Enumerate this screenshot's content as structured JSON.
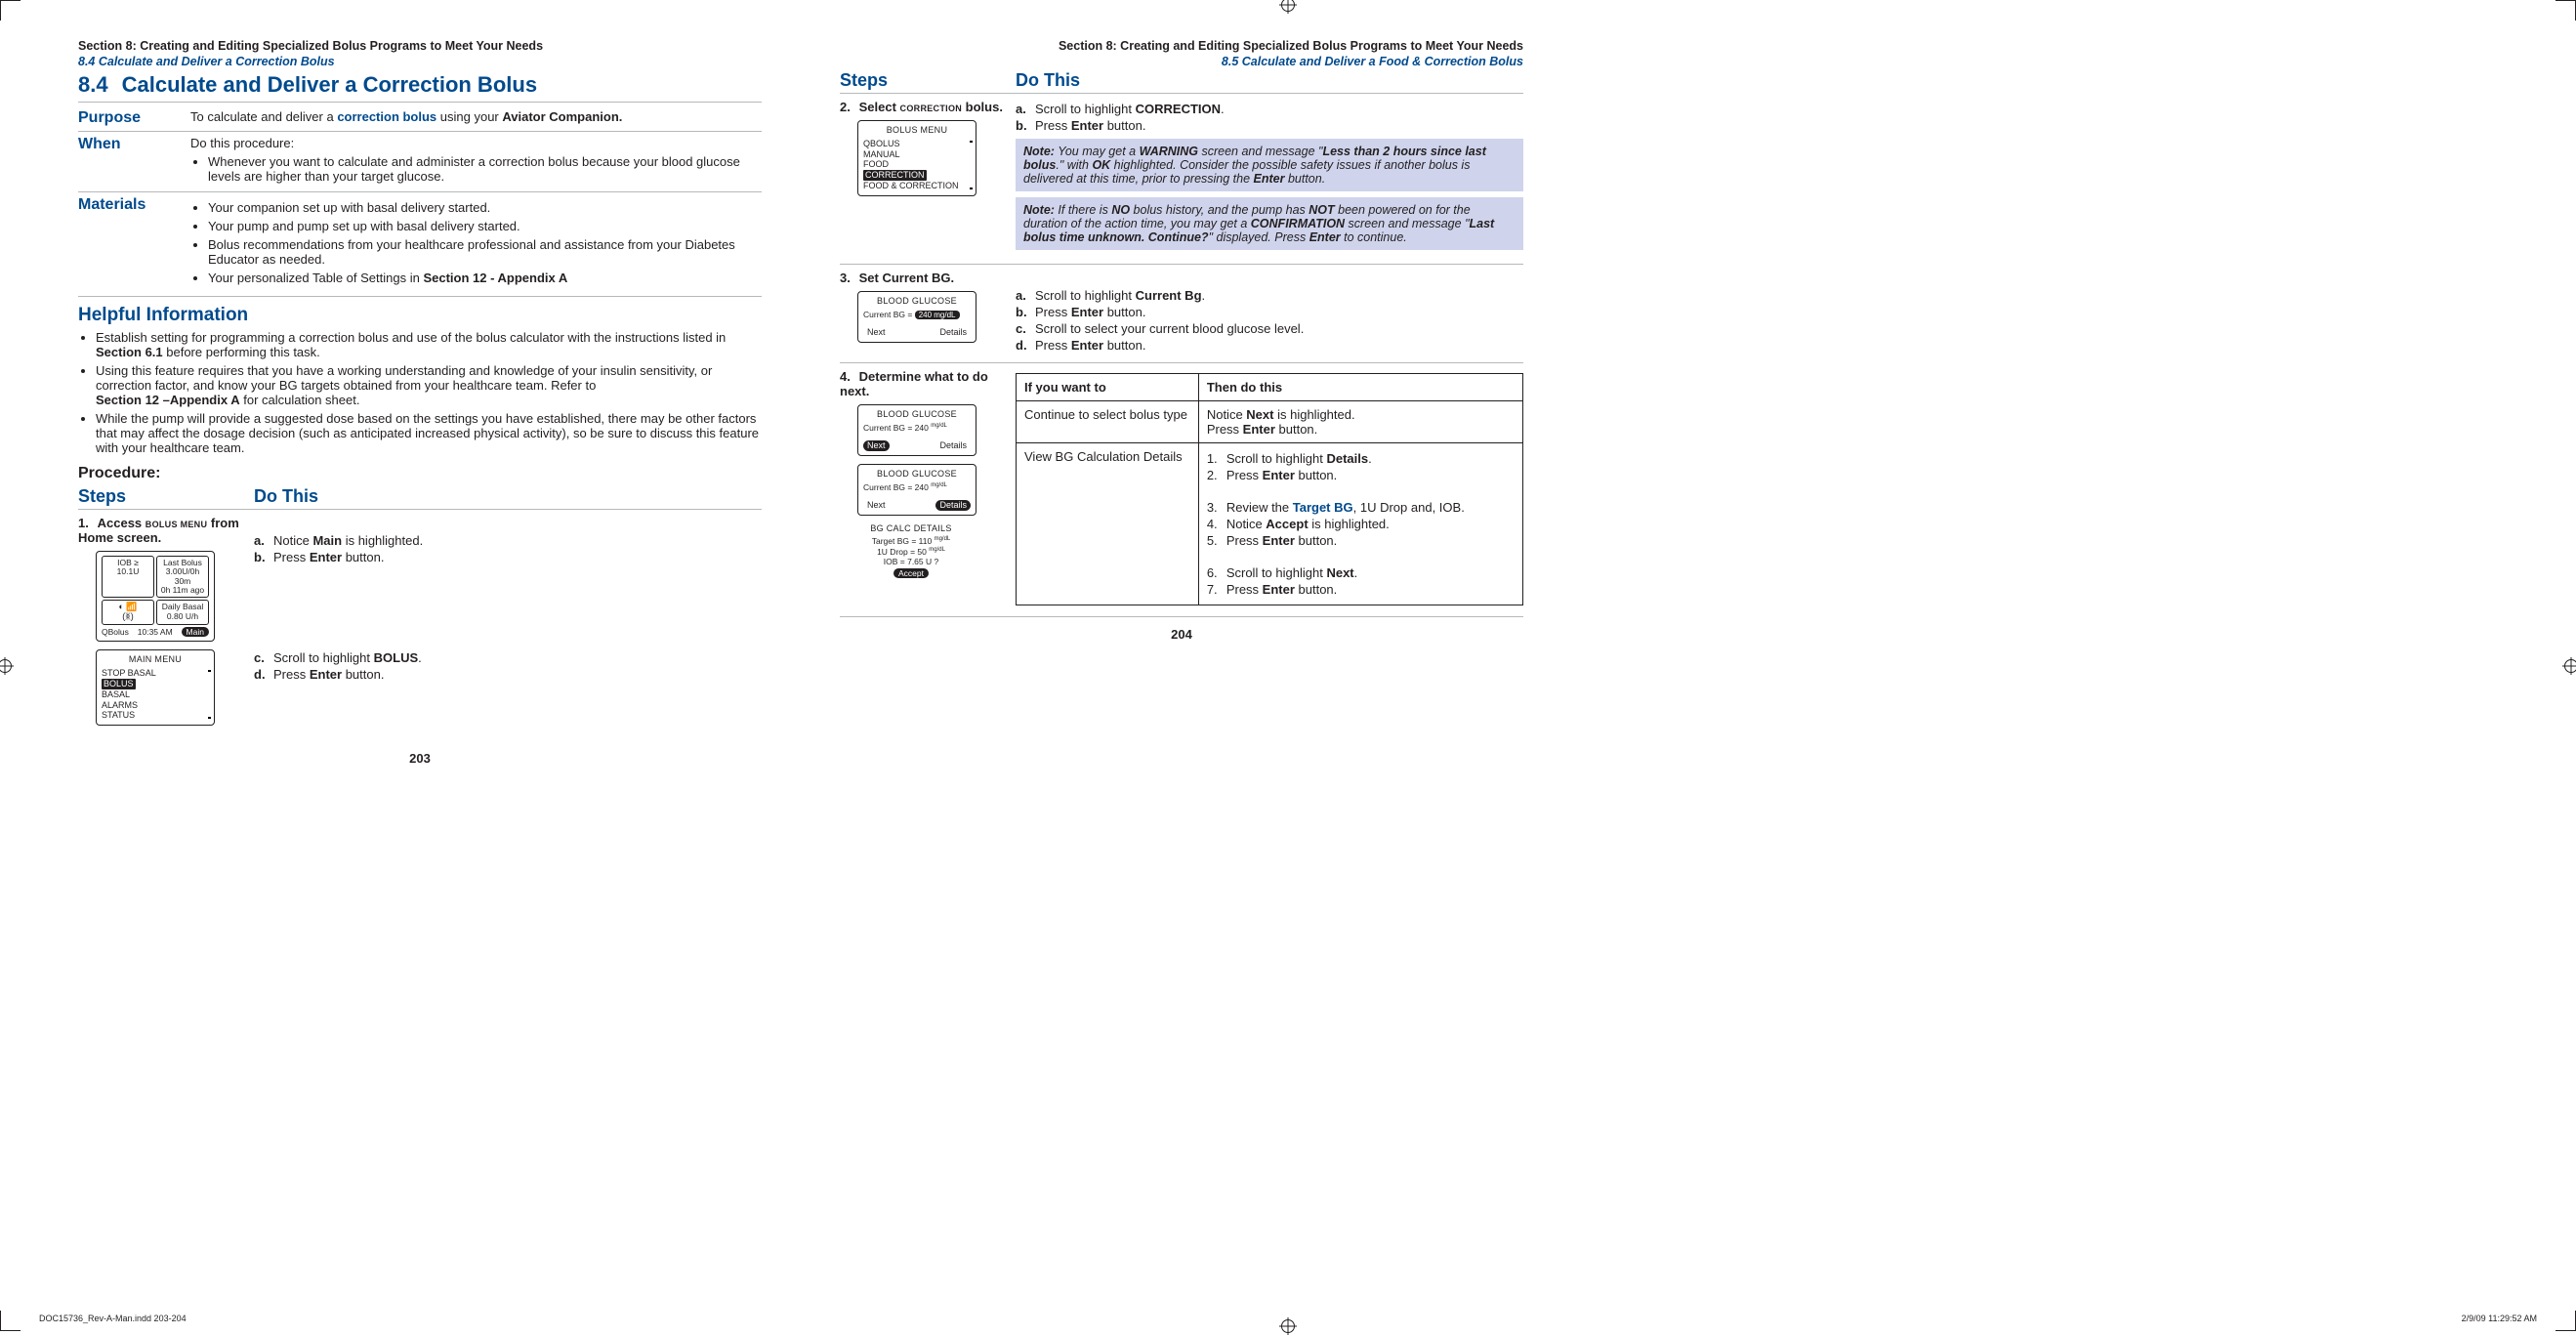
{
  "left": {
    "running_head": "Section 8: Creating and Editing Specialized Bolus Programs to Meet Your Needs",
    "running_sub": "8.4 Calculate and Deliver a Correction Bolus",
    "h1_num": "8.4",
    "h1_title": "Calculate and Deliver a Correction Bolus",
    "purpose_label": "Purpose",
    "purpose_pre": "To calculate and deliver a ",
    "purpose_term": "correction bolus",
    "purpose_post": " using your ",
    "purpose_bold": "Aviator Companion.",
    "when_label": "When",
    "when_intro": "Do this procedure:",
    "when_item": "Whenever you want to calculate and administer a correction bolus because your blood glucose levels are higher than your target glucose.",
    "materials_label": "Materials",
    "materials": [
      "Your companion set up with basal delivery started.",
      "Your pump and pump set up with basal delivery started.",
      "Bolus recommendations from your healthcare professional and assistance from your Diabetes Educator as needed.",
      "Your personalized Table of Settings in "
    ],
    "materials_boldref": "Section 12 - Appendix A",
    "helpful_heading": "Helpful Information",
    "helpful_items": [
      {
        "pre": "Establish setting for programming a correction bolus and use of the bolus calculator with the instructions listed in ",
        "bold": "Section 6.1",
        "post": " before performing this task."
      },
      {
        "pre": "Using this feature requires that you have a working understanding and knowledge of your insulin sensitivity, or correction factor, and know your BG targets obtained from your healthcare team. Refer to ",
        "bold": "Section 12 –Appendix A",
        "post": " for calculation sheet."
      },
      {
        "pre": "While the pump will provide a suggested dose based on the settings you have established, there may be other factors that may affect the dosage decision (such as anticipated increased physical activity), so be sure to discuss this feature with your healthcare team.",
        "bold": "",
        "post": ""
      }
    ],
    "procedure_label": "Procedure:",
    "steps_col1": "Steps",
    "steps_col2": "Do This",
    "step1_num": "1.",
    "step1_title_a": "Access ",
    "step1_title_caps": "BOLUS MENU",
    "step1_title_b": " from Home screen.",
    "step1_a_pre": "Notice ",
    "step1_a_bold": "Main",
    "step1_a_post": " is highlighted.",
    "step1_b_pre": "Press ",
    "step1_b_bold": "Enter",
    "step1_b_post": " button.",
    "step1_c_pre": "Scroll to highlight ",
    "step1_c_bold": "BOLUS",
    "step1_c_post": ".",
    "step1_d_pre": "Press ",
    "step1_d_bold": "Enter",
    "step1_d_post": " button.",
    "home_iob_label": "IOB ≥",
    "home_iob_val": "10.1U",
    "home_lastbolus_l1": "Last Bolus",
    "home_lastbolus_l2": "3.00U/0h 30m",
    "home_lastbolus_l3": "0h 11m ago",
    "home_basal_l1": "Daily Basal",
    "home_basal_l2": "0.80 U/h",
    "home_foot_left": "QBolus",
    "home_foot_time": "10:35 AM",
    "home_foot_main": "Main",
    "mainmenu_title": "MAIN MENU",
    "mainmenu_items": [
      "STOP BASAL",
      "BOLUS",
      "BASAL",
      "ALARMS",
      "STATUS"
    ],
    "page_num": "203"
  },
  "right": {
    "running_head": "Section 8: Creating and Editing Specialized Bolus Programs to Meet Your Needs",
    "running_sub": "8.5 Calculate and Deliver a Food & Correction Bolus",
    "steps_col1": "Steps",
    "steps_col2": "Do This",
    "step2_num": "2.",
    "step2_title_a": "Select ",
    "step2_title_caps": "CORRECTION",
    "step2_title_b": " bolus.",
    "step2_a_pre": "Scroll to highlight ",
    "step2_a_bold": "CORRECTION",
    "step2_a_post": ".",
    "step2_b_pre": "Press ",
    "step2_b_bold": "Enter",
    "step2_b_post": " button.",
    "bolusmenu_title": "BOLUS MENU",
    "bolusmenu_items": [
      "QBOLUS",
      "MANUAL",
      "FOOD",
      "CORRECTION",
      "FOOD & CORRECTION"
    ],
    "note1_lead": "Note:",
    "note1_a": " You may get a ",
    "note1_warn": "WARNING",
    "note1_b": " screen and message \"",
    "note1_msg": "Less than 2 hours since last bolus",
    "note1_c": ".\" with ",
    "note1_ok": "OK",
    "note1_d": " highlighted. Consider the possible safety issues if another bolus is delivered at this time, prior to pressing the ",
    "note1_enter": "Enter",
    "note1_e": " button.",
    "note2_lead": "Note:",
    "note2_a": " If there is ",
    "note2_no": "NO",
    "note2_b": " bolus history, and the pump has ",
    "note2_not": "NOT",
    "note2_c": " been powered on for the duration of the action time, you may get a ",
    "note2_conf": "CONFIRMATION",
    "note2_d": " screen and message \"",
    "note2_msg": "Last bolus time unknown. Continue?",
    "note2_e": "\" displayed. Press ",
    "note2_enter": "Enter",
    "note2_f": " to continue.",
    "step3_num": "3.",
    "step3_title": "Set Current BG.",
    "bg_title": "BLOOD GLUCOSE",
    "bg_label": "Current BG =",
    "bg_val": "240  mg/dL",
    "bg_next": "Next",
    "bg_details": "Details",
    "step3_a_pre": "Scroll to highlight ",
    "step3_a_bold": "Current Bg",
    "step3_a_post": ".",
    "step3_b_pre": "Press ",
    "step3_b_bold": "Enter",
    "step3_b_post": " button.",
    "step3_c": "Scroll to select your current blood glucose level.",
    "step3_d_pre": "Press ",
    "step3_d_bold": "Enter",
    "step3_d_post": " button.",
    "step4_num": "4.",
    "step4_title": "Determine what to do next.",
    "bg2_curbg": "Current BG = 240 ",
    "bg2_unit": "mg/dL",
    "calc_title": "BG CALC DETAILS",
    "calc_l1": "Target BG = 110 ",
    "calc_l2": "1U Drop = 50 ",
    "calc_l3": "IOB = 7.65 U ?",
    "calc_accept": "Accept",
    "tbl_h1": "If you want to",
    "tbl_h2": "Then do this",
    "tbl_r1c1": "Continue to select bolus type",
    "tbl_r1c2_a": "Notice ",
    "tbl_r1c2_bold": "Next",
    "tbl_r1c2_b": " is highlighted.",
    "tbl_r1c2_c": "Press ",
    "tbl_r1c2_bold2": "Enter",
    "tbl_r1c2_d": " button.",
    "tbl_r2c1": "View BG Calculation Details",
    "tbl_r2_1a": "Scroll to highlight ",
    "tbl_r2_1b": "Details",
    "tbl_r2_1c": ".",
    "tbl_r2_2a": "Press ",
    "tbl_r2_2b": "Enter",
    "tbl_r2_2c": " button.",
    "tbl_r2_3a": "Review the ",
    "tbl_r2_3link": "Target BG",
    "tbl_r2_3b": ", 1U Drop and, IOB.",
    "tbl_r2_4a": "Notice ",
    "tbl_r2_4b": "Accept",
    "tbl_r2_4c": " is highlighted.",
    "tbl_r2_5a": "Press ",
    "tbl_r2_5b": "Enter",
    "tbl_r2_5c": " button.",
    "tbl_r2_6a": "Scroll to highlight ",
    "tbl_r2_6b": "Next",
    "tbl_r2_6c": ".",
    "tbl_r2_7a": "Press ",
    "tbl_r2_7b": "Enter",
    "tbl_r2_7c": " button.",
    "page_num": "204"
  },
  "footer_left": "DOC15736_Rev-A-Man.indd   203-204",
  "footer_right": "2/9/09   11:29:52 AM"
}
